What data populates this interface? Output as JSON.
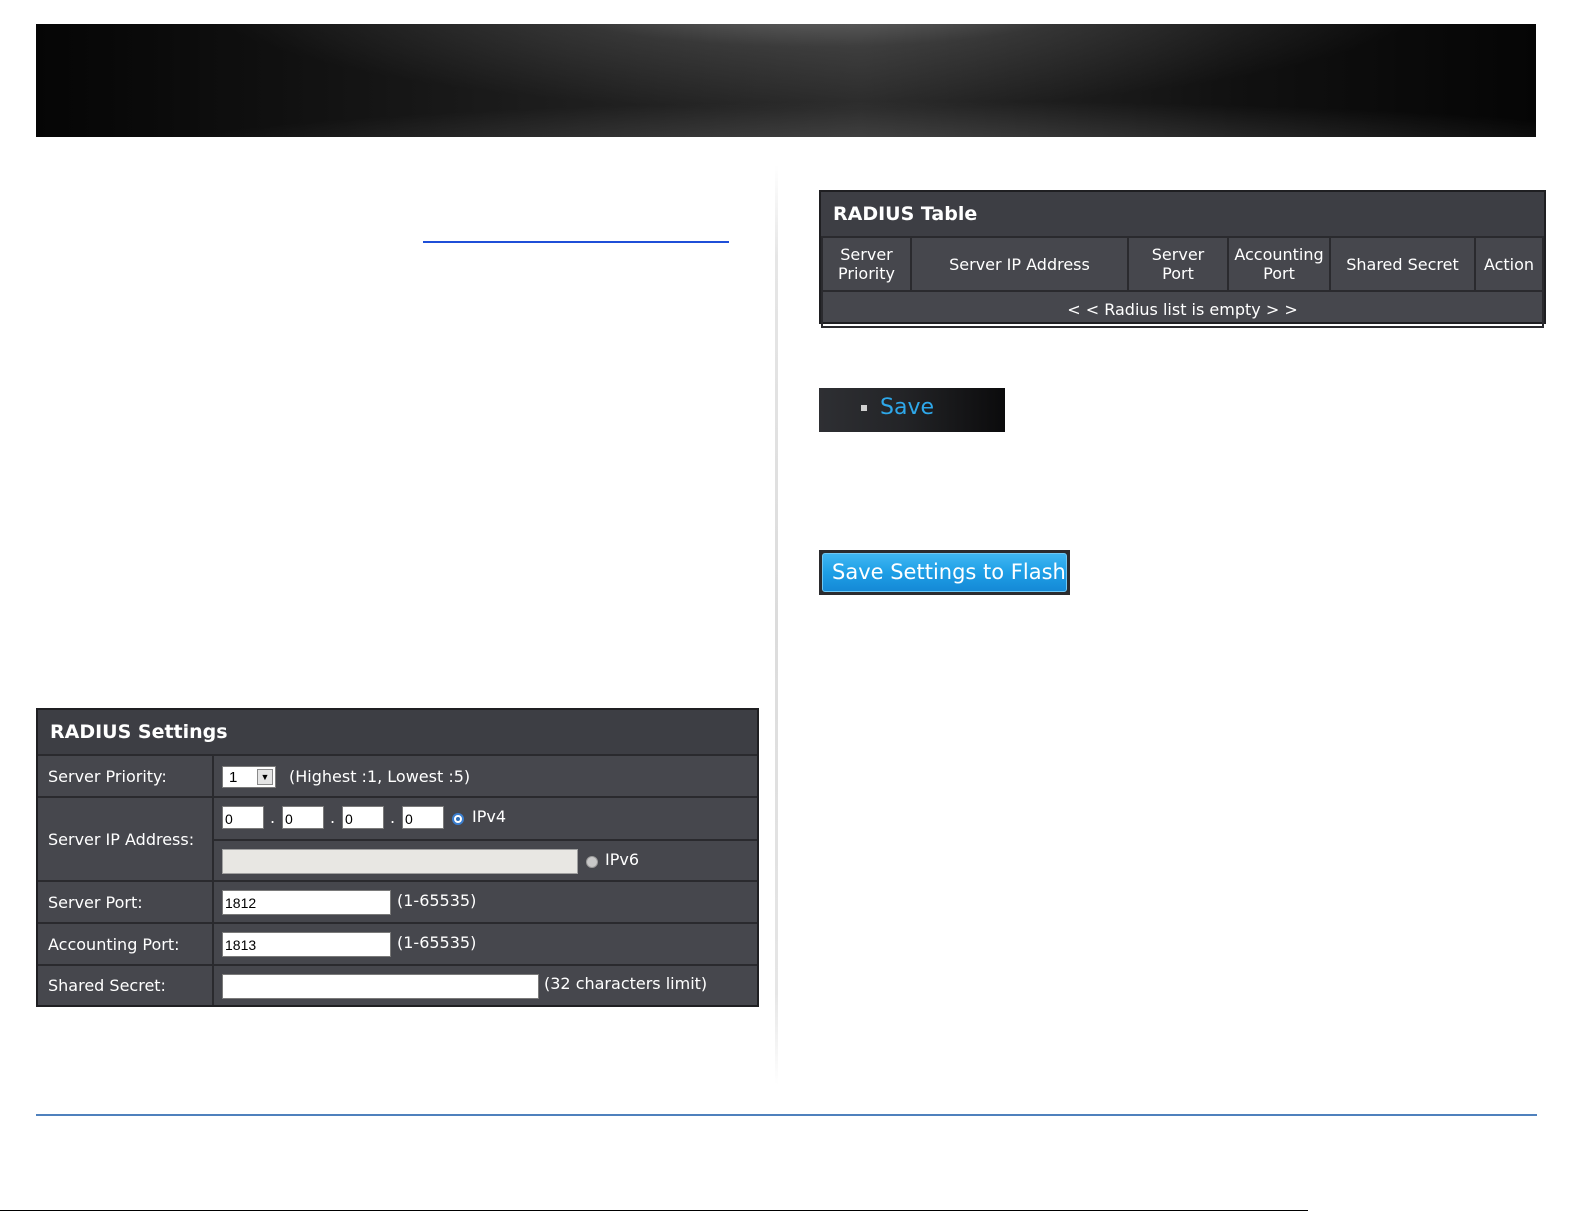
{
  "settings": {
    "title": "RADIUS Settings",
    "priority_label": "Server Priority:",
    "priority_value": "1",
    "priority_hint": "(Highest :1, Lowest :5)",
    "ip_label": "Server IP Address:",
    "ipv4_octets": [
      "0",
      "0",
      "0",
      "0"
    ],
    "ipv4_dot": ".",
    "ipv4_label": "IPv4",
    "ipv6_value": "",
    "ipv6_label": "IPv6",
    "selected_ip_version": "IPv4",
    "port_label": "Server Port:",
    "port_value": "1812",
    "port_hint": "(1-65535)",
    "acct_label": "Accounting Port:",
    "acct_value": "1813",
    "acct_hint": "(1-65535)",
    "secret_label": "Shared Secret:",
    "secret_value": "",
    "secret_hint": "(32 characters limit)"
  },
  "table": {
    "title": "RADIUS Table",
    "columns": [
      "Server Priority",
      "Server IP Address",
      "Server Port",
      "Accounting Port",
      "Shared Secret",
      "Action"
    ],
    "empty_message": "< < Radius list is empty > >"
  },
  "buttons": {
    "save": "Save",
    "save_flash": "Save Settings to Flash"
  },
  "colors": {
    "panel_bg": "#46474d",
    "save_text": "#2ea8ea",
    "flash_button": "#1e9fe6",
    "rule": "#4f81bd"
  }
}
